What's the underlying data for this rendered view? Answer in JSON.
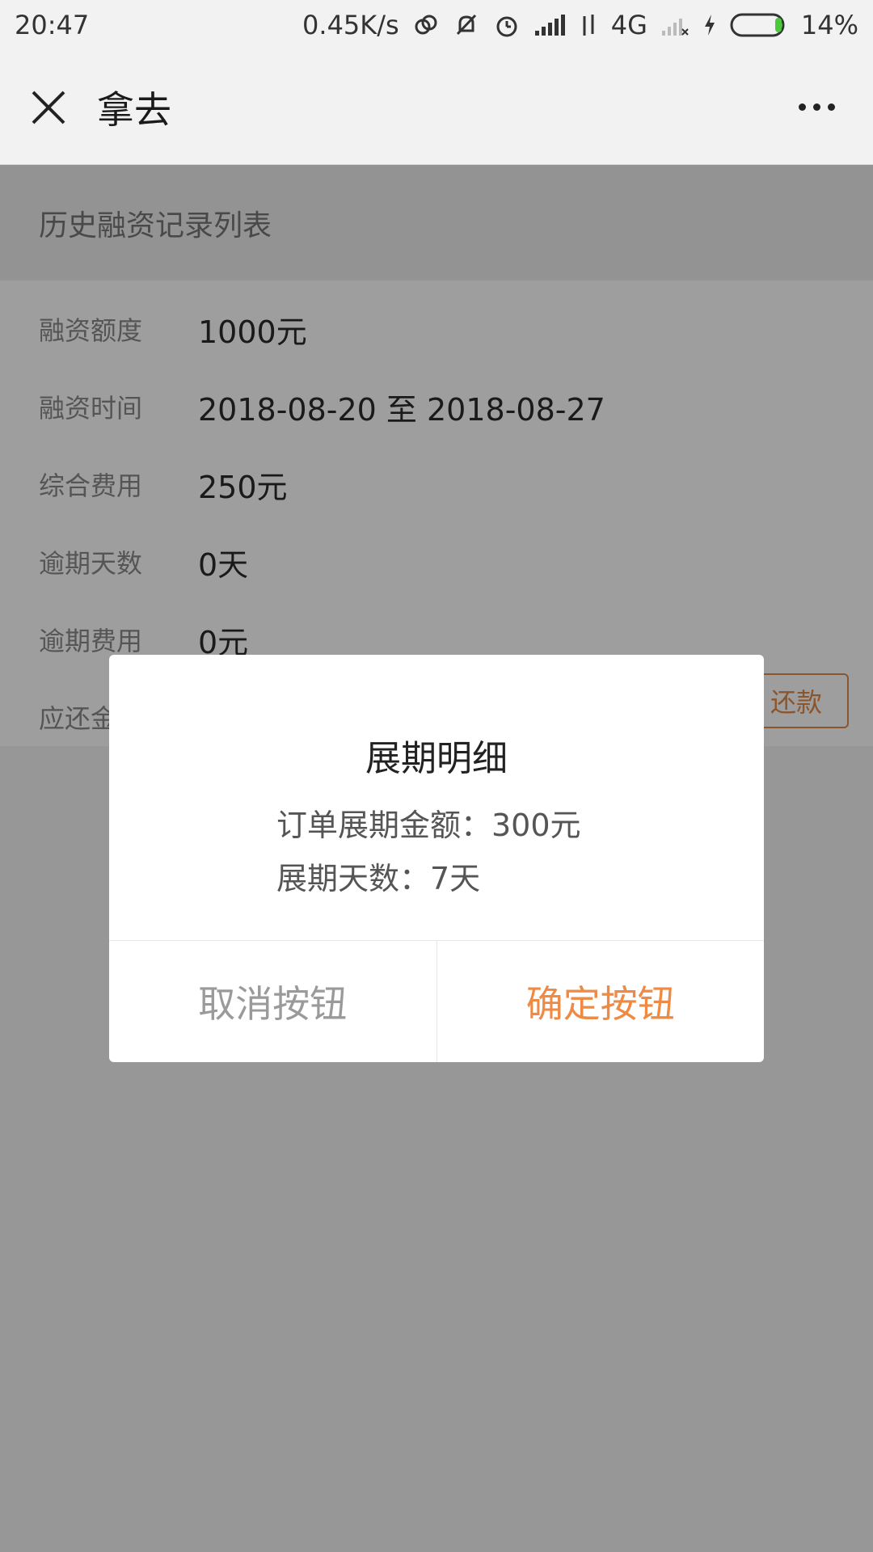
{
  "status_bar": {
    "time": "20:47",
    "network_speed": "0.45K/s",
    "network_type": "4G",
    "battery": "14%"
  },
  "nav": {
    "title": "拿去"
  },
  "page": {
    "section_title": "历史融资记录列表",
    "rows": [
      {
        "label": "融资额度",
        "value": "1000元"
      },
      {
        "label": "融资时间",
        "value": "2018-08-20 至 2018-08-27"
      },
      {
        "label": "综合费用",
        "value": "250元"
      },
      {
        "label": "逾期天数",
        "value": "0天"
      },
      {
        "label": "逾期费用",
        "value": "0元"
      },
      {
        "label": "应还金",
        "value": ""
      }
    ],
    "repay_label": "还款"
  },
  "dialog": {
    "title": "展期明细",
    "lines": [
      "订单展期金额：300元",
      "展期天数：7天"
    ],
    "cancel_label": "取消按钮",
    "confirm_label": "确定按钮"
  },
  "colors": {
    "accent": "#ef8a45",
    "repay_border": "#e08a4a"
  }
}
